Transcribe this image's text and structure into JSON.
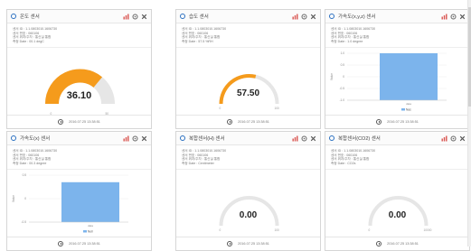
{
  "panels": [
    {
      "title": "온도 센서",
      "info": [
        "센서 ID : 1.1.0803010.1606730",
        "센서 번호 : 060106",
        "센서 위치/주차 : 통신실 통합",
        "측정 Date : 00.1 degC"
      ],
      "type": "gauge",
      "value_text": "36.10",
      "value_fraction": 0.72,
      "gauge_color": "#f59b1c",
      "gauge_style": "thick",
      "min_label": "0",
      "max_label": "50",
      "timestamp": "2016.07.25 13:38:51"
    },
    {
      "title": "습도 센서",
      "info": [
        "센서 ID : 1.1.0803010.1606730",
        "센서 번호 : 060106",
        "센서 위치/주차 : 통신실 통합",
        "측정 Date : 57.5 %RH"
      ],
      "type": "gauge",
      "value_text": "57.50",
      "value_fraction": 0.575,
      "gauge_color": "#f59b1c",
      "gauge_style": "thin",
      "min_label": "0",
      "max_label": "100",
      "timestamp": "2016.07.25 13:38:51"
    },
    {
      "title": "가속도(x,y,z) 센서",
      "info": [
        "센서 ID : 1.1.0803010.1606730",
        "센서 번호 : 060106",
        "센서 위치/주차 : 통신실 통합",
        "측정 Date : 1.0 degree"
      ],
      "type": "bar",
      "timestamp": "2016.07.25 13:38:51",
      "chart_data": {
        "type": "bar",
        "categories": [
          "data"
        ],
        "series": [
          {
            "name": "Nas",
            "values": [
              1.0
            ]
          }
        ],
        "yticks": [
          "1.0",
          "0.5",
          "0",
          "-0.5",
          "-1.0"
        ],
        "ylim": [
          -1.0,
          1.0
        ],
        "ylabel": "Value",
        "bar_color": "#7cb4ec"
      }
    },
    {
      "title": "가속도(x) 센서",
      "info": [
        "센서 ID : 1.1.0803010.1606730",
        "센서 번호 : 060106",
        "센서 위치/주차 : 통신실 통합",
        "측정 Date : 00.3 degree"
      ],
      "type": "bar",
      "timestamp": "2016.07.25 13:38:51",
      "chart_data": {
        "type": "bar",
        "categories": [
          "data"
        ],
        "series": [
          {
            "name": "Null",
            "values": [
              0.35
            ]
          }
        ],
        "yticks": [
          "0.5",
          "0",
          "-0.5"
        ],
        "ylim": [
          -0.5,
          0.5
        ],
        "ylabel": "Value",
        "bar_color": "#7cb4ec"
      }
    },
    {
      "title": "복합센서(H) 센서",
      "info": [
        "센서 ID : 1.1.0803010.1606730",
        "센서 번호 : 060106",
        "센서 위치/주차 : 통신실 통합",
        "측정 Date : Centimeter"
      ],
      "type": "gauge",
      "value_text": "0.00",
      "value_fraction": 0,
      "gauge_color": "#f59b1c",
      "gauge_style": "thin",
      "min_label": "0",
      "max_label": "100",
      "timestamp": "2016.07.25 13:38:51"
    },
    {
      "title": "복합센서(CO2) 센서",
      "info": [
        "센서 ID : 1.1.0803010.1606730",
        "센서 번호 : 060106",
        "센서 위치/주차 : 통신실 통합",
        "측정 Date : CO2s"
      ],
      "type": "gauge",
      "value_text": "0.00",
      "value_fraction": 0,
      "gauge_color": "#f59b1c",
      "gauge_style": "thin",
      "min_label": "0",
      "max_label": "10000",
      "timestamp": "2016.07.25 13:38:51"
    }
  ],
  "colors": {
    "accent": "#2a6fc1",
    "tool_red": "#d9534f",
    "gauge_track": "#e6e6e6"
  }
}
